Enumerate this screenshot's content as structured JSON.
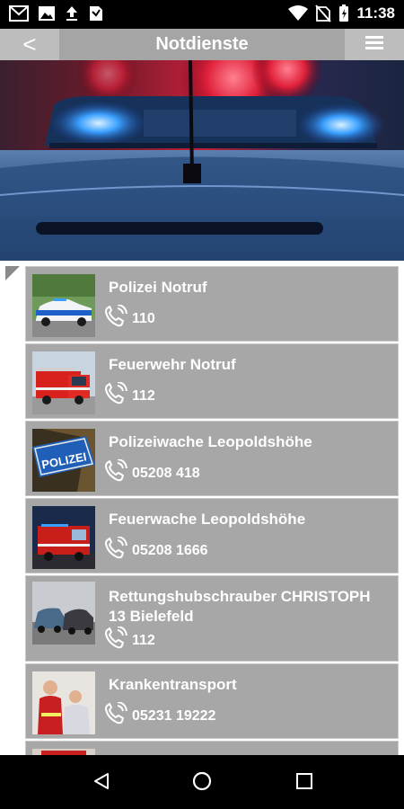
{
  "status_bar": {
    "time": "11:38",
    "left_icons": [
      "gmail-icon",
      "image-icon",
      "upload-icon",
      "download-app-icon"
    ],
    "right_icons": [
      "wifi-icon",
      "no-sim-icon",
      "battery-icon"
    ]
  },
  "appbar": {
    "back_label": "<",
    "title": "Notdienste",
    "menu_icon": "hamburger-icon"
  },
  "colors": {
    "appbar": "#a5a5a5",
    "appbar_button": "#bdbdbd",
    "card": "#a7a7a7",
    "text": "#ffffff"
  },
  "entries": [
    {
      "name": "Polizei Notruf",
      "phone": "110",
      "image": "police-car"
    },
    {
      "name": "Feuerwehr Notruf",
      "phone": "112",
      "image": "fire-truck"
    },
    {
      "name": "Polizeiwache Leopoldshöhe",
      "phone": "05208 418",
      "image": "polizei-sign"
    },
    {
      "name": "Feuerwache Leopoldshöhe",
      "phone": "05208 1666",
      "image": "fire-truck-night"
    },
    {
      "name": "Rettungshubschrauber CHRISTOPH 13 Bielefeld",
      "phone": "112",
      "image": "car-accident"
    },
    {
      "name": "Krankentransport",
      "phone": "05231 19222",
      "image": "paramedics"
    }
  ],
  "navbar": {
    "items": [
      "back-nav-icon",
      "home-nav-icon",
      "recents-nav-icon"
    ]
  }
}
